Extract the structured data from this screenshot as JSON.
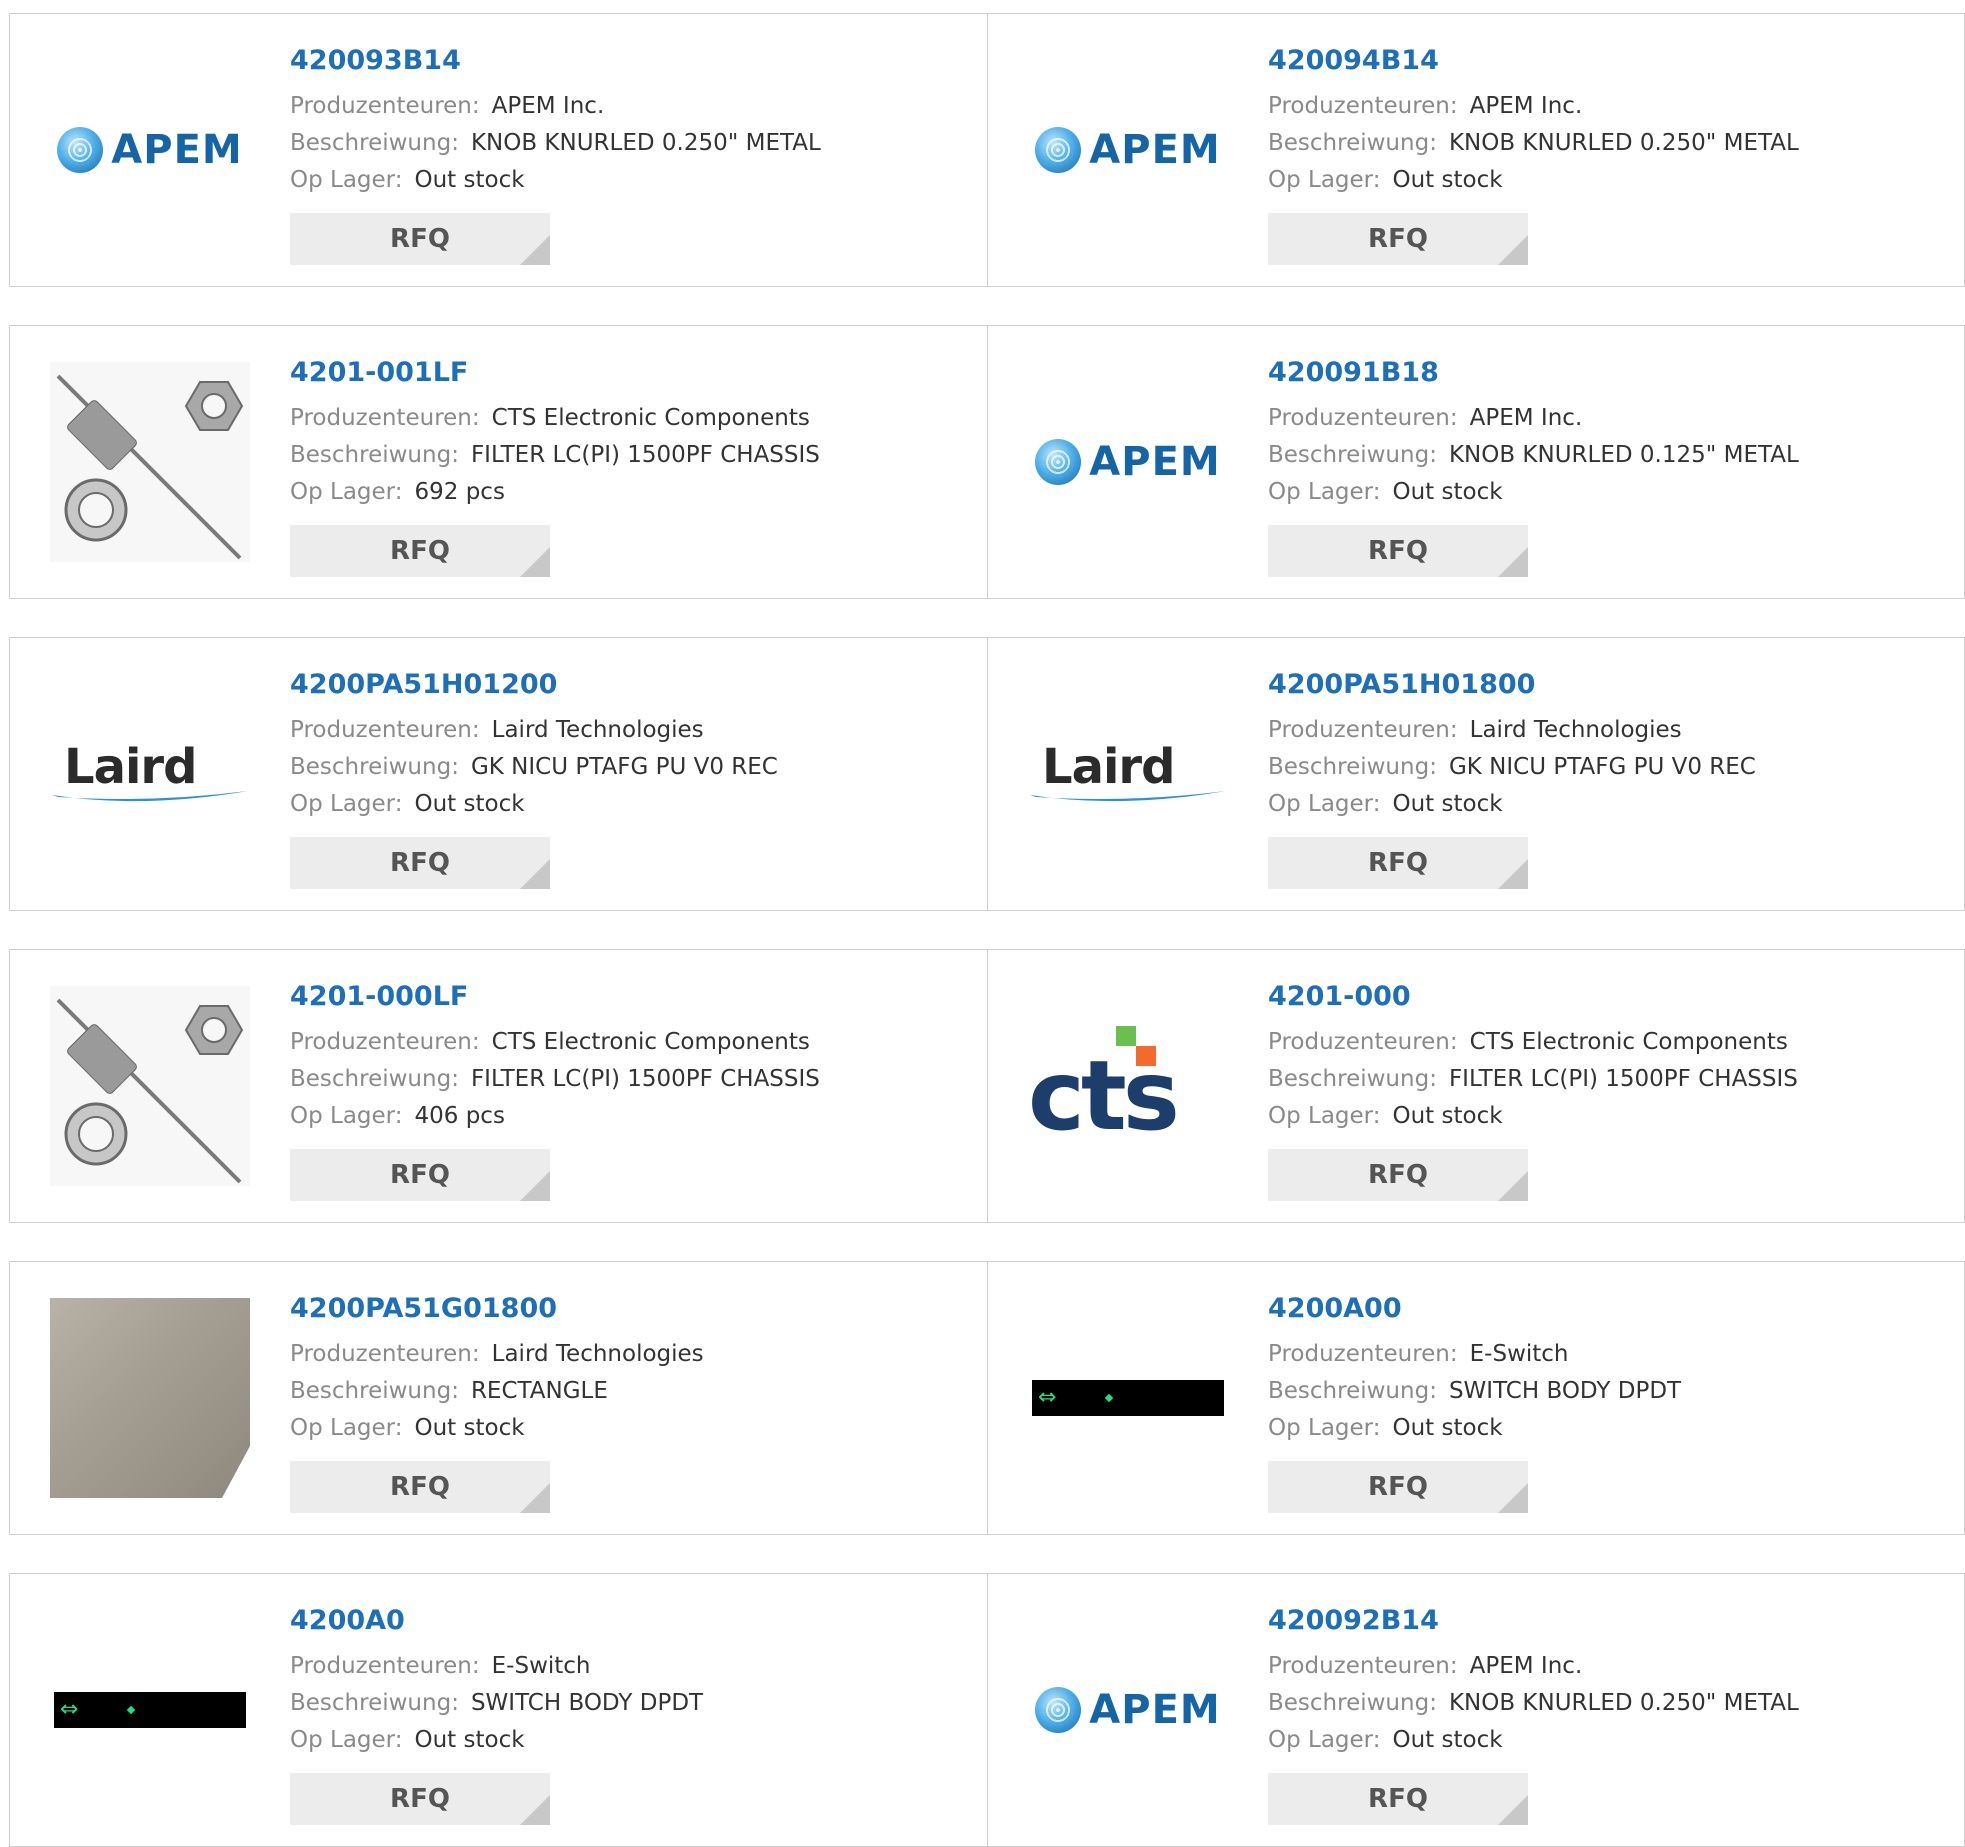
{
  "labels": {
    "manufacturer": "Produzenteuren:",
    "description": "Beschreiwung:",
    "stock": "Op Lager:",
    "rfq": "RFQ"
  },
  "products": [
    {
      "part": "420093B14",
      "manufacturer": "APEM Inc.",
      "description": "KNOB KNURLED 0.250\" METAL",
      "stock": "Out stock",
      "image": "apem-logo"
    },
    {
      "part": "420094B14",
      "manufacturer": "APEM Inc.",
      "description": "KNOB KNURLED 0.250\" METAL",
      "stock": "Out stock",
      "image": "apem-logo"
    },
    {
      "part": "4201-001LF",
      "manufacturer": "CTS Electronic Components",
      "description": "FILTER LC(PI) 1500PF CHASSIS",
      "stock": "692 pcs",
      "image": "filter-photo"
    },
    {
      "part": "420091B18",
      "manufacturer": "APEM Inc.",
      "description": "KNOB KNURLED 0.125\" METAL",
      "stock": "Out stock",
      "image": "apem-logo"
    },
    {
      "part": "4200PA51H01200",
      "manufacturer": "Laird Technologies",
      "description": "GK NICU PTAFG PU V0 REC",
      "stock": "Out stock",
      "image": "laird-logo"
    },
    {
      "part": "4200PA51H01800",
      "manufacturer": "Laird Technologies",
      "description": "GK NICU PTAFG PU V0 REC",
      "stock": "Out stock",
      "image": "laird-logo"
    },
    {
      "part": "4201-000LF",
      "manufacturer": "CTS Electronic Components",
      "description": "FILTER LC(PI) 1500PF CHASSIS",
      "stock": "406 pcs",
      "image": "filter-photo"
    },
    {
      "part": "4201-000",
      "manufacturer": "CTS Electronic Components",
      "description": "FILTER LC(PI) 1500PF CHASSIS",
      "stock": "Out stock",
      "image": "cts-logo"
    },
    {
      "part": "4200PA51G01800",
      "manufacturer": "Laird Technologies",
      "description": "RECTANGLE",
      "stock": "Out stock",
      "image": "gasket-strip-photo"
    },
    {
      "part": "4200A00",
      "manufacturer": "E-Switch",
      "description": "SWITCH BODY DPDT",
      "stock": "Out stock",
      "image": "switch-body-image"
    },
    {
      "part": "4200A0",
      "manufacturer": "E-Switch",
      "description": "SWITCH BODY DPDT",
      "stock": "Out stock",
      "image": "switch-body-image"
    },
    {
      "part": "420092B14",
      "manufacturer": "APEM Inc.",
      "description": "KNOB KNURLED 0.250\" METAL",
      "stock": "Out stock",
      "image": "apem-logo"
    }
  ],
  "logos": {
    "apem": "APEM",
    "laird": "Laird",
    "cts": "cts"
  },
  "colors": {
    "link": "#1d6fb8",
    "label": "#8a8a8a",
    "button_bg": "#ececec"
  }
}
